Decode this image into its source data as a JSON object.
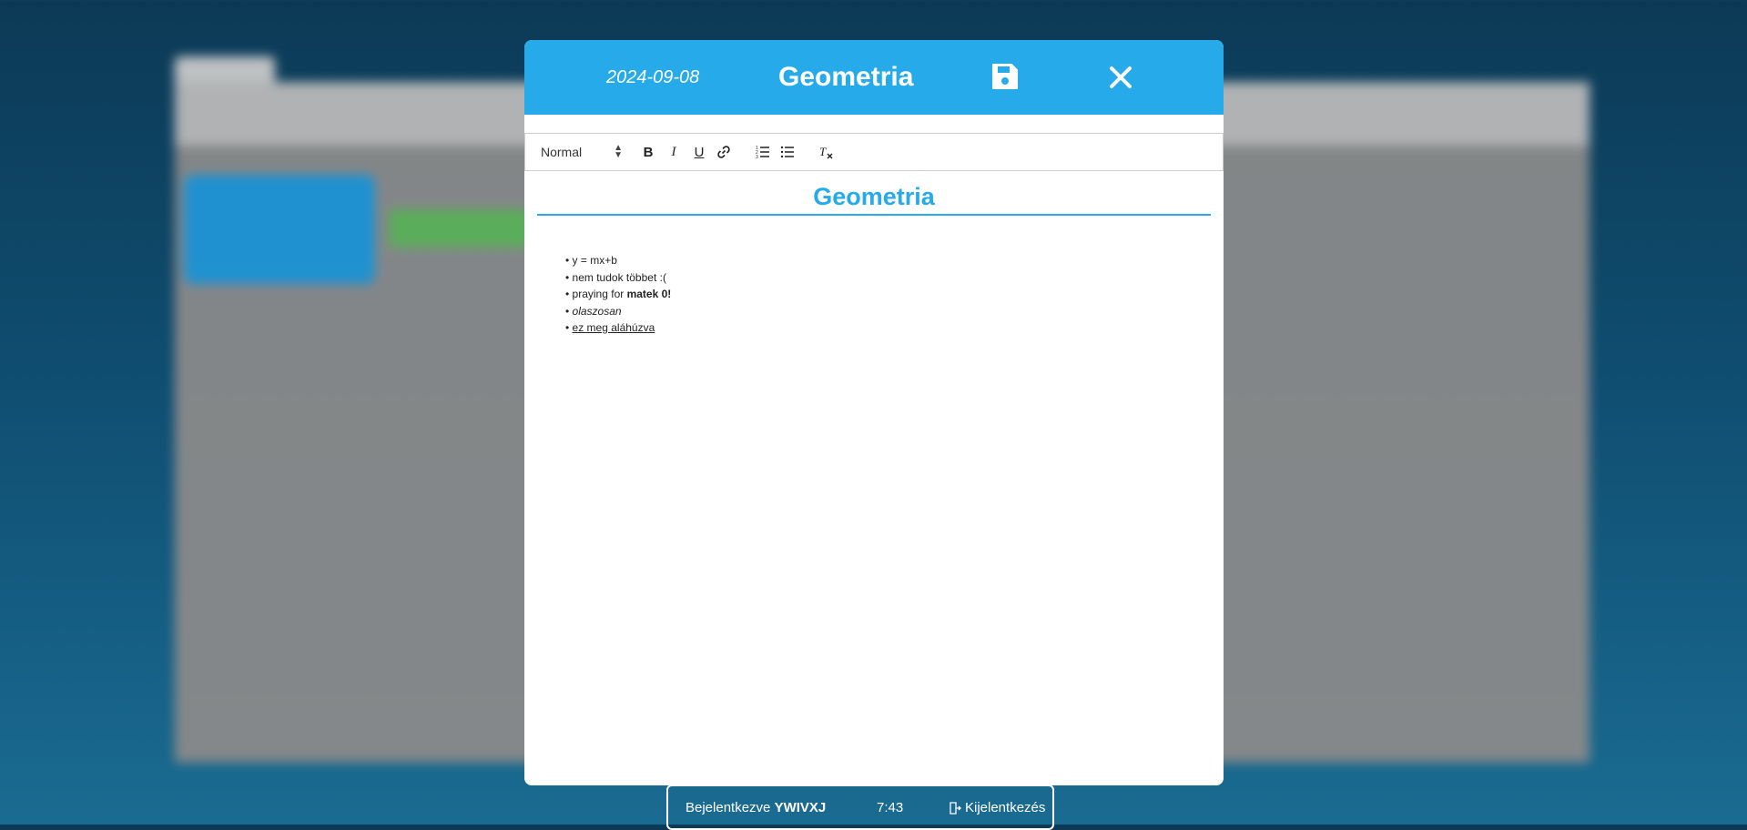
{
  "modal": {
    "date": "2024-09-08",
    "title": "Geometria",
    "save_icon": "save-icon",
    "close_icon": "close-icon"
  },
  "toolbar": {
    "format_select": "Normal",
    "buttons": [
      "bold",
      "italic",
      "underline",
      "link",
      "ordered-list",
      "bullet-list",
      "clear-format"
    ]
  },
  "editor": {
    "heading": "Geometria",
    "bullets": [
      {
        "text": "y = mx+b"
      },
      {
        "text": "nem tudok többet :("
      },
      {
        "prefix": "praying for ",
        "bold": "matek 0!"
      },
      {
        "italic": "olaszosan"
      },
      {
        "underline": "ez meg aláhúzva"
      }
    ]
  },
  "statusbar": {
    "logged_in_label": "Bejelentkezve",
    "username": "YWIVXJ",
    "time": "7:43",
    "logout_label": "Kijelentkezés"
  },
  "colors": {
    "accent": "#26aae9",
    "bg": "#0f4d70"
  }
}
